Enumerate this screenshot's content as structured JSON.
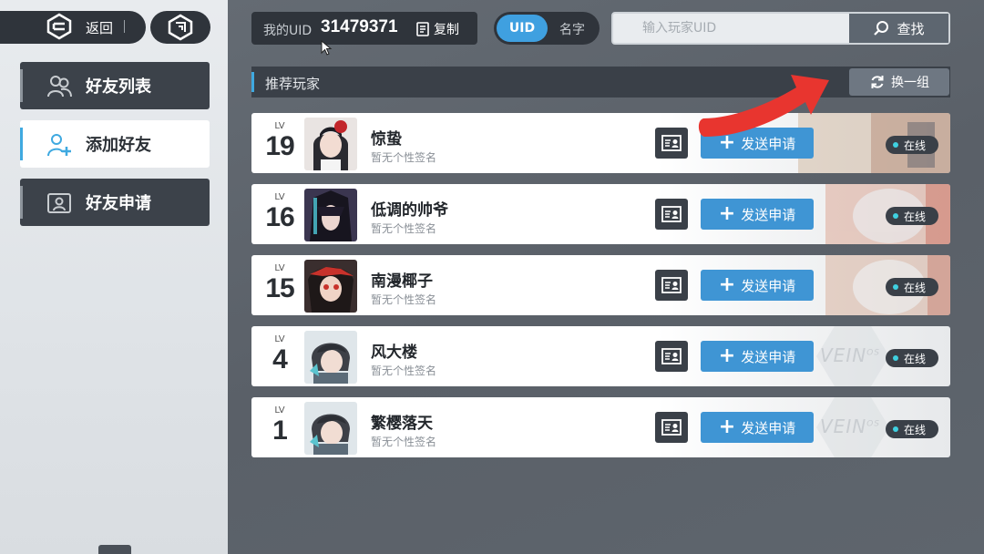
{
  "nav": {
    "back_label": "返回",
    "items": [
      {
        "label": "好友列表",
        "active": false
      },
      {
        "label": "添加好友",
        "active": true
      },
      {
        "label": "好友申请",
        "active": false
      }
    ]
  },
  "uid": {
    "prefix": "我的UID",
    "value": "31479371",
    "copy_label": "复制"
  },
  "search_mode": {
    "uid_label": "UID",
    "name_label": "名字",
    "selected": "UID"
  },
  "search": {
    "placeholder": "输入玩家UID",
    "button_label": "查找"
  },
  "recommend": {
    "title": "推荐玩家",
    "refresh_label": "换一组"
  },
  "players": [
    {
      "lv_label": "LV",
      "level": "19",
      "name": "惊蛰",
      "signature": "暂无个性签名",
      "send_label": "发送申请",
      "status": "在线"
    },
    {
      "lv_label": "LV",
      "level": "16",
      "name": "低调的帅爷",
      "signature": "暂无个性签名",
      "send_label": "发送申请",
      "status": "在线"
    },
    {
      "lv_label": "LV",
      "level": "15",
      "name": "南漫椰子",
      "signature": "暂无个性签名",
      "send_label": "发送申请",
      "status": "在线"
    },
    {
      "lv_label": "LV",
      "level": "4",
      "name": "风大楼",
      "signature": "暂无个性签名",
      "send_label": "发送申请",
      "status": "在线"
    },
    {
      "lv_label": "LV",
      "level": "1",
      "name": "繁樱落天",
      "signature": "暂无个性签名",
      "send_label": "发送申请",
      "status": "在线"
    }
  ],
  "colors": {
    "accent": "#3fa9e0",
    "send_button": "#3f95d4",
    "online_dot": "#3fd0e0",
    "arrow": "#e8352f"
  }
}
